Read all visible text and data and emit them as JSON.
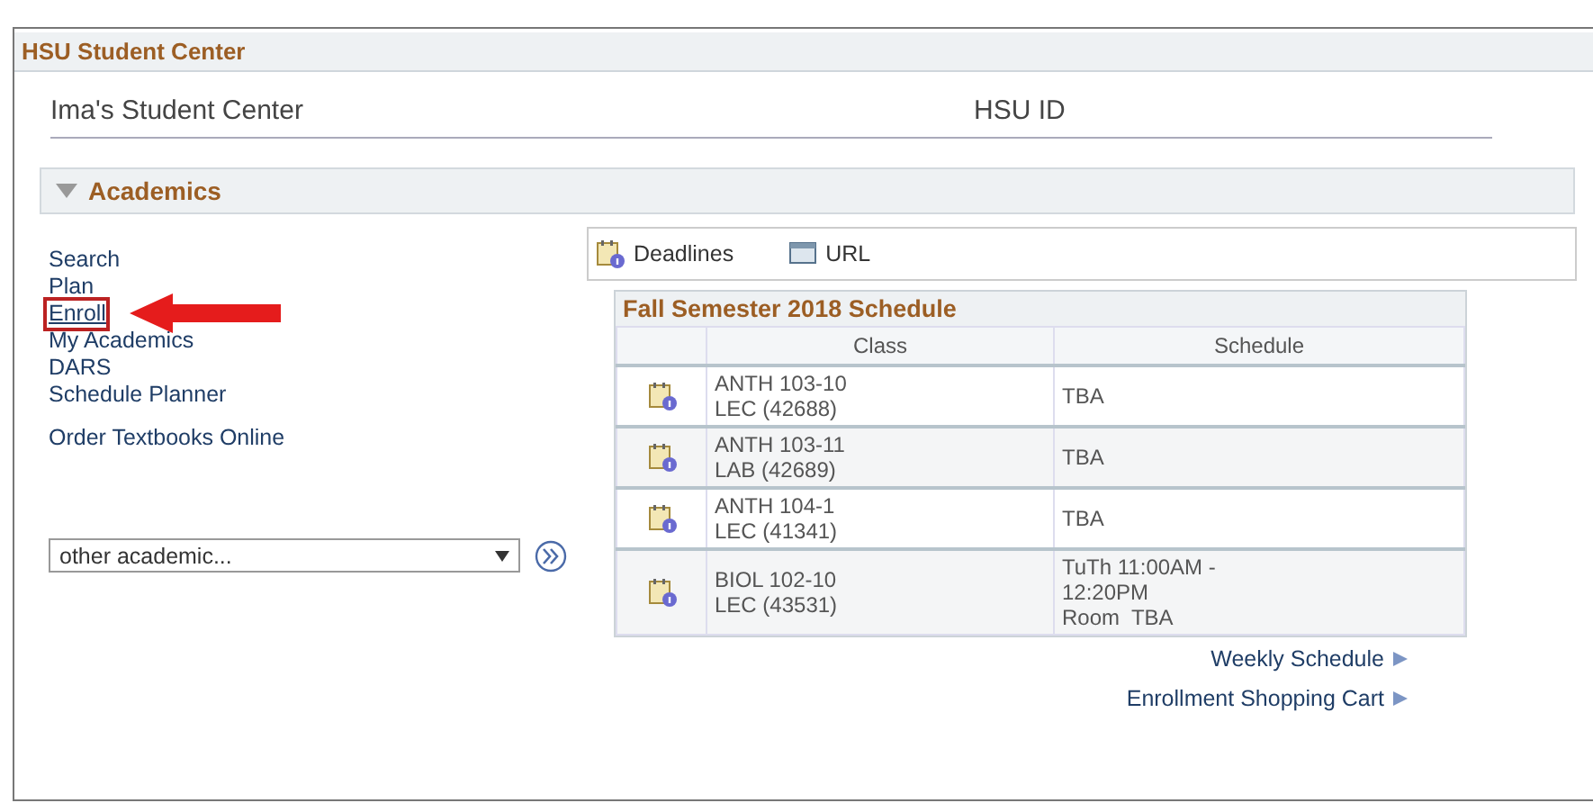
{
  "header": {
    "title": "HSU Student Center"
  },
  "student": {
    "name": "Ima's Student Center",
    "id_label": "HSU ID"
  },
  "section": {
    "title": "Academics",
    "expanded": true
  },
  "links": [
    {
      "label": "Search",
      "highlighted": false
    },
    {
      "label": "Plan",
      "highlighted": false
    },
    {
      "label": "Enroll",
      "highlighted": true
    },
    {
      "label": "My Academics",
      "highlighted": false
    },
    {
      "label": "DARS",
      "highlighted": false
    },
    {
      "label": "Schedule Planner",
      "highlighted": false
    }
  ],
  "extra_link": "Order Textbooks Online",
  "dropdown": {
    "value": "other academic..."
  },
  "toolbar": [
    "Deadlines",
    "URL"
  ],
  "schedule": {
    "title": "Fall Semester 2018 Schedule",
    "columns": [
      "Class",
      "Schedule"
    ],
    "rows": [
      {
        "class": [
          "ANTH 103-10",
          "LEC (42688)"
        ],
        "schedule": [
          "TBA"
        ]
      },
      {
        "class": [
          "ANTH 103-11",
          "LAB (42689)"
        ],
        "schedule": [
          "TBA"
        ]
      },
      {
        "class": [
          "ANTH 104-1",
          "LEC (41341)"
        ],
        "schedule": [
          "TBA"
        ]
      },
      {
        "class": [
          "BIOL 102-10",
          "LEC (43531)"
        ],
        "schedule": [
          "TuTh 11:00AM -",
          "12:20PM",
          "Room  TBA"
        ]
      }
    ]
  },
  "footer_links": [
    "Weekly Schedule",
    "Enrollment Shopping Cart"
  ]
}
